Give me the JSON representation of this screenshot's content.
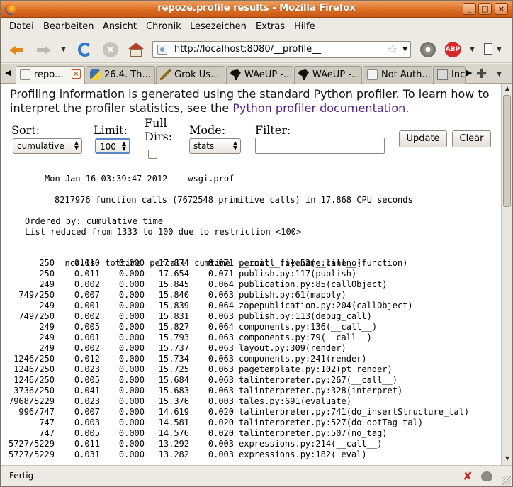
{
  "window": {
    "title": "repoze.profile results - Mozilla Firefox"
  },
  "menu": [
    "Datei",
    "Bearbeiten",
    "Ansicht",
    "Chronik",
    "Lesezeichen",
    "Extras",
    "Hilfe"
  ],
  "menu_mnemonics": [
    "D",
    "B",
    "A",
    "C",
    "L",
    "E",
    "H"
  ],
  "nav": {
    "url": "http://localhost:8080/__profile__"
  },
  "tabs": [
    {
      "label": "repo...",
      "icon": "page-icon",
      "active": true
    },
    {
      "label": "26.4. Th...",
      "icon": "python-icon"
    },
    {
      "label": "Grok Us...",
      "icon": "wand-icon"
    },
    {
      "label": "WAeUP -...",
      "icon": "africa-icon"
    },
    {
      "label": "WAeUP -...",
      "icon": "africa-icon"
    },
    {
      "label": "Not Auth...",
      "icon": "page-icon"
    },
    {
      "label": "Inc",
      "icon": "folder-icon"
    }
  ],
  "intro": {
    "text": "Profiling information is generated using the standard Python profiler. To learn how to interpret the profiler statistics, see the ",
    "link": "Python profiler documentation",
    "suffix": "."
  },
  "form": {
    "sort_label": "Sort:",
    "sort_value": "cumulative",
    "limit_label": "Limit:",
    "limit_value": "100",
    "fulldirs_label_1": "Full",
    "fulldirs_label_2": "Dirs:",
    "mode_label": "Mode:",
    "mode_value": "stats",
    "filter_label": "Filter:",
    "filter_value": "",
    "update_label": "Update",
    "clear_label": "Clear"
  },
  "report": {
    "header_line": "Mon Jan 16 03:39:47 2012    wsgi.prof",
    "summary_line": "8217976 function calls (7672548 primitive calls) in 17.868 CPU seconds",
    "ordered_line": "Ordered by: cumulative time",
    "reduced_line": "List reduced from 1333 to 100 due to restriction <100>",
    "columns": [
      "ncalls",
      "tottime",
      "percall",
      "cumtime",
      "percall",
      "filename:lineno(function)"
    ],
    "rows": [
      [
        "250",
        "0.010",
        "0.000",
        "17.874",
        "0.071",
        "__init__.py:52(__call__)"
      ],
      [
        "250",
        "0.011",
        "0.000",
        "17.654",
        "0.071",
        "publish.py:117(publish)"
      ],
      [
        "249",
        "0.002",
        "0.000",
        "15.845",
        "0.064",
        "publication.py:85(callObject)"
      ],
      [
        "749/250",
        "0.007",
        "0.000",
        "15.840",
        "0.063",
        "publish.py:61(mapply)"
      ],
      [
        "249",
        "0.001",
        "0.000",
        "15.839",
        "0.064",
        "zopepublication.py:204(callObject)"
      ],
      [
        "749/250",
        "0.002",
        "0.000",
        "15.831",
        "0.063",
        "publish.py:113(debug_call)"
      ],
      [
        "249",
        "0.005",
        "0.000",
        "15.827",
        "0.064",
        "components.py:136(__call__)"
      ],
      [
        "249",
        "0.001",
        "0.000",
        "15.793",
        "0.063",
        "components.py:79(__call__)"
      ],
      [
        "249",
        "0.002",
        "0.000",
        "15.737",
        "0.063",
        "layout.py:309(render)"
      ],
      [
        "1246/250",
        "0.012",
        "0.000",
        "15.734",
        "0.063",
        "components.py:241(render)"
      ],
      [
        "1246/250",
        "0.023",
        "0.000",
        "15.725",
        "0.063",
        "pagetemplate.py:102(pt_render)"
      ],
      [
        "1246/250",
        "0.005",
        "0.000",
        "15.684",
        "0.063",
        "talinterpreter.py:267(__call__)"
      ],
      [
        "3736/250",
        "0.041",
        "0.000",
        "15.683",
        "0.063",
        "talinterpreter.py:328(interpret)"
      ],
      [
        "7968/5229",
        "0.023",
        "0.000",
        "15.376",
        "0.003",
        "tales.py:691(evaluate)"
      ],
      [
        "996/747",
        "0.007",
        "0.000",
        "14.619",
        "0.020",
        "talinterpreter.py:741(do_insertStructure_tal)"
      ],
      [
        "747",
        "0.003",
        "0.000",
        "14.581",
        "0.020",
        "talinterpreter.py:527(do_optTag_tal)"
      ],
      [
        "747",
        "0.005",
        "0.000",
        "14.576",
        "0.020",
        "talinterpreter.py:507(no_tag)"
      ],
      [
        "5727/5229",
        "0.011",
        "0.000",
        "13.292",
        "0.003",
        "expressions.py:214(__call__)"
      ],
      [
        "5727/5229",
        "0.031",
        "0.000",
        "13.282",
        "0.003",
        "expressions.py:182(_eval)"
      ]
    ]
  },
  "status": {
    "text": "Fertig"
  }
}
